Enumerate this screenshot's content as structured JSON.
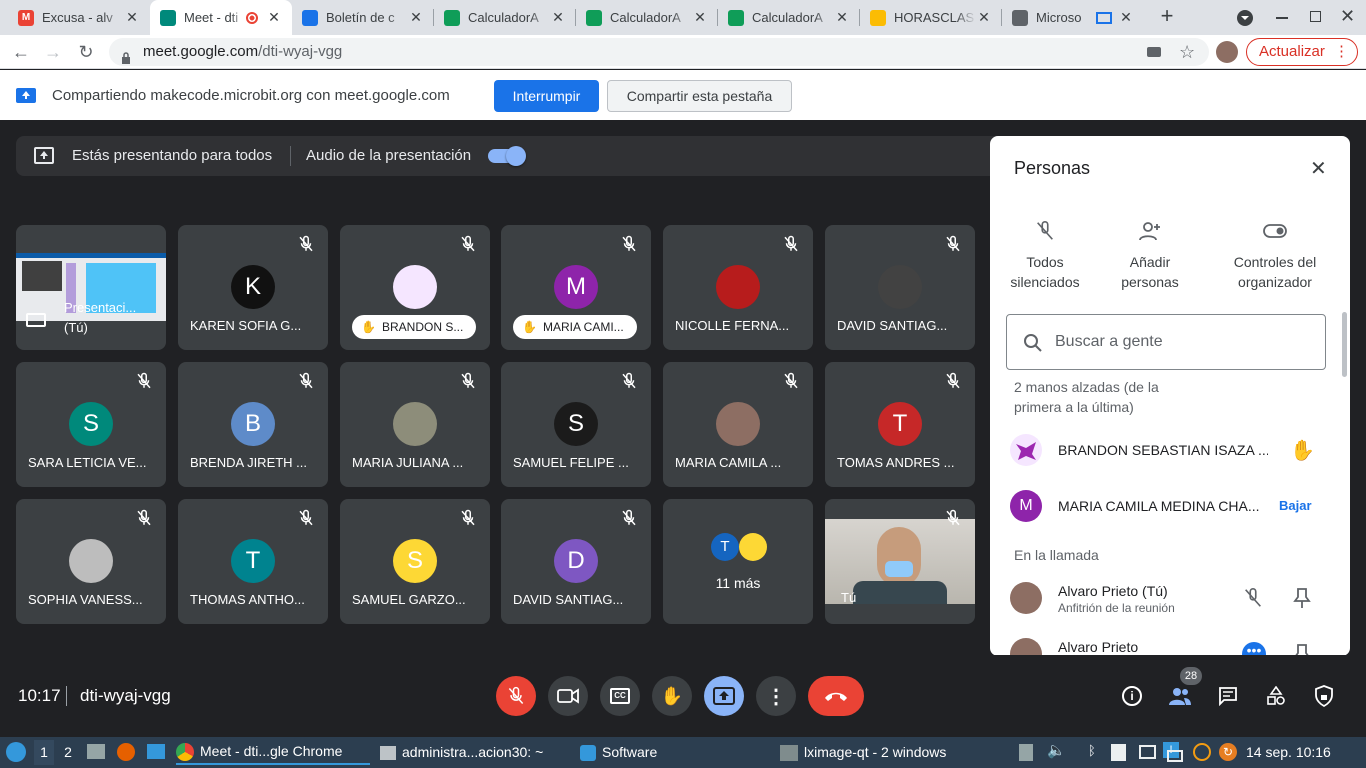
{
  "browser": {
    "tabs": [
      {
        "title": "Excusa - alv",
        "fav_color": "#ea4335",
        "fav_glyph": "M"
      },
      {
        "title": "Meet - dti",
        "fav_color": "#00897b",
        "fav_glyph": ""
      },
      {
        "title": "Boletín de c",
        "fav_color": "#1a73e8",
        "fav_glyph": ""
      },
      {
        "title": "CalculadorA",
        "fav_color": "#0f9d58",
        "fav_glyph": ""
      },
      {
        "title": "CalculadorA",
        "fav_color": "#0f9d58",
        "fav_glyph": ""
      },
      {
        "title": "CalculadorA",
        "fav_color": "#0f9d58",
        "fav_glyph": ""
      },
      {
        "title": "HORASCLAS",
        "fav_color": "#fbbc04",
        "fav_glyph": ""
      },
      {
        "title": "Microso",
        "fav_color": "#5f6368",
        "fav_glyph": ""
      }
    ],
    "url_host": "meet.google.com",
    "url_path": "/dti-wyaj-vgg",
    "update_label": "Actualizar"
  },
  "share_banner": {
    "text": "Compartiendo makecode.microbit.org con meet.google.com",
    "stop_label": "Interrumpir",
    "share_tab_label": "Compartir esta pestaña"
  },
  "presenting": {
    "text": "Estás presentando para todos",
    "audio_label": "Audio de la presentación"
  },
  "tiles": [
    {
      "name": "Presentaci...",
      "sub": "(Tú)",
      "kind": "screen"
    },
    {
      "name": "KAREN SOFIA G...",
      "avatar": "K",
      "color": "#111111"
    },
    {
      "name": "BRANDON S...",
      "avatar": "",
      "color": "#f5e6ff",
      "hand": true
    },
    {
      "name": "MARIA CAMI...",
      "avatar": "M",
      "color": "#8e24aa",
      "hand": true
    },
    {
      "name": "NICOLLE FERNA...",
      "avatar": "",
      "color": "#b71c1c"
    },
    {
      "name": "DAVID SANTIAG...",
      "avatar": "",
      "color": "#424242"
    },
    {
      "name": "SARA LETICIA VE...",
      "avatar": "S",
      "color": "#00897b"
    },
    {
      "name": "BRENDA JIRETH ...",
      "avatar": "B",
      "color": "#5e8bc9"
    },
    {
      "name": "MARIA JULIANA ...",
      "avatar": "",
      "color": "#8d8d7a"
    },
    {
      "name": "SAMUEL FELIPE ...",
      "avatar": "S",
      "color": "#1b1b1b"
    },
    {
      "name": "MARIA CAMILA ...",
      "avatar": "",
      "color": "#8d6e63"
    },
    {
      "name": "TOMAS ANDRES ...",
      "avatar": "T",
      "color": "#c62828"
    },
    {
      "name": "SOPHIA VANESS...",
      "avatar": "",
      "color": "#bdbdbd"
    },
    {
      "name": "THOMAS ANTHO...",
      "avatar": "T",
      "color": "#00838f"
    },
    {
      "name": "SAMUEL GARZO...",
      "avatar": "S",
      "color": "#fdd835"
    },
    {
      "name": "DAVID SANTIAG...",
      "avatar": "D",
      "color": "#7e57c2"
    },
    {
      "name": "11 más",
      "avatar": "T",
      "color": "#1565c0",
      "kind": "more"
    },
    {
      "name": "Tú",
      "kind": "camera"
    }
  ],
  "panel": {
    "title": "Personas",
    "actions": [
      "Todos silenciados",
      "Añadir personas",
      "Controles del organizador"
    ],
    "search_placeholder": "Buscar a gente",
    "hands_heading": "2 manos alzadas (de la primera a la última)",
    "hands": [
      {
        "name": "BRANDON SEBASTIAN ISAZA ...",
        "avatar": "",
        "color": "#f5e6ff"
      },
      {
        "name": "MARIA CAMILA MEDINA CHA...",
        "avatar": "M",
        "color": "#8e24aa",
        "action": "Bajar"
      }
    ],
    "in_call_heading": "En la llamada",
    "participants": [
      {
        "name": "Alvaro Prieto (Tú)",
        "role": "Anfitrión de la reunión"
      },
      {
        "name": "Alvaro Prieto",
        "role": ""
      }
    ]
  },
  "meeting": {
    "time": "10:17",
    "code": "dti-wyaj-vgg",
    "people_count": "28"
  },
  "taskbar": {
    "workspaces": [
      "1",
      "2"
    ],
    "tasks": [
      "Meet - dti...gle Chrome",
      "administra...acion30: ~",
      "Software",
      "lximage-qt - 2 windows"
    ],
    "clock": "14 sep. 10:16"
  }
}
